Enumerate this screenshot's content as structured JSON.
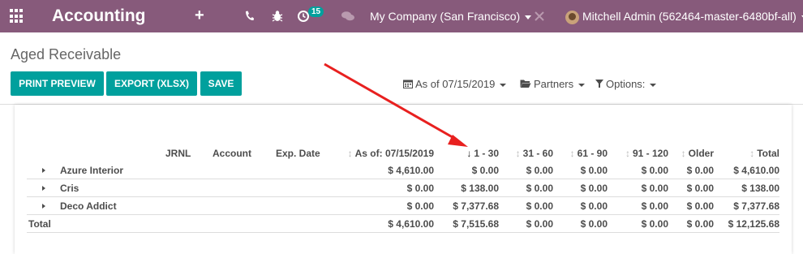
{
  "navbar": {
    "app_title": "Accounting",
    "plus": "+",
    "badge": "15",
    "company": "My Company (San Francisco)",
    "user": "Mitchell Admin (562464-master-6480bf-all)",
    "icons": [
      "apps-icon",
      "phone-icon",
      "bug-icon",
      "activity-clock-icon",
      "chat-icon",
      "tools-icon"
    ]
  },
  "control_panel": {
    "title": "Aged Receivable",
    "buttons": {
      "print": "PRINT PREVIEW",
      "export": "EXPORT (XLSX)",
      "save": "SAVE"
    },
    "filters": {
      "date": "As of 07/15/2019",
      "partners": "Partners",
      "options": "Options:"
    }
  },
  "report": {
    "columns": [
      "JRNL",
      "Account",
      "Exp. Date",
      "As of: 07/15/2019",
      "1 - 30",
      "31 - 60",
      "61 - 90",
      "91 - 120",
      "Older",
      "Total"
    ],
    "rows": [
      {
        "name": "Azure Interior",
        "values": [
          "$ 4,610.00",
          "$ 0.00",
          "$ 0.00",
          "$ 0.00",
          "$ 0.00",
          "$ 0.00",
          "$ 4,610.00"
        ]
      },
      {
        "name": "Cris",
        "values": [
          "$ 0.00",
          "$ 138.00",
          "$ 0.00",
          "$ 0.00",
          "$ 0.00",
          "$ 0.00",
          "$ 138.00"
        ]
      },
      {
        "name": "Deco Addict",
        "values": [
          "$ 0.00",
          "$ 7,377.68",
          "$ 0.00",
          "$ 0.00",
          "$ 0.00",
          "$ 0.00",
          "$ 7,377.68"
        ]
      }
    ],
    "total": {
      "name": "Total",
      "values": [
        "$ 4,610.00",
        "$ 7,515.68",
        "$ 0.00",
        "$ 0.00",
        "$ 0.00",
        "$ 0.00",
        "$ 12,125.68"
      ]
    }
  },
  "colors": {
    "navbar": "#875a7b",
    "primary": "#00a09d",
    "annotation_arrow": "#e8201f"
  }
}
